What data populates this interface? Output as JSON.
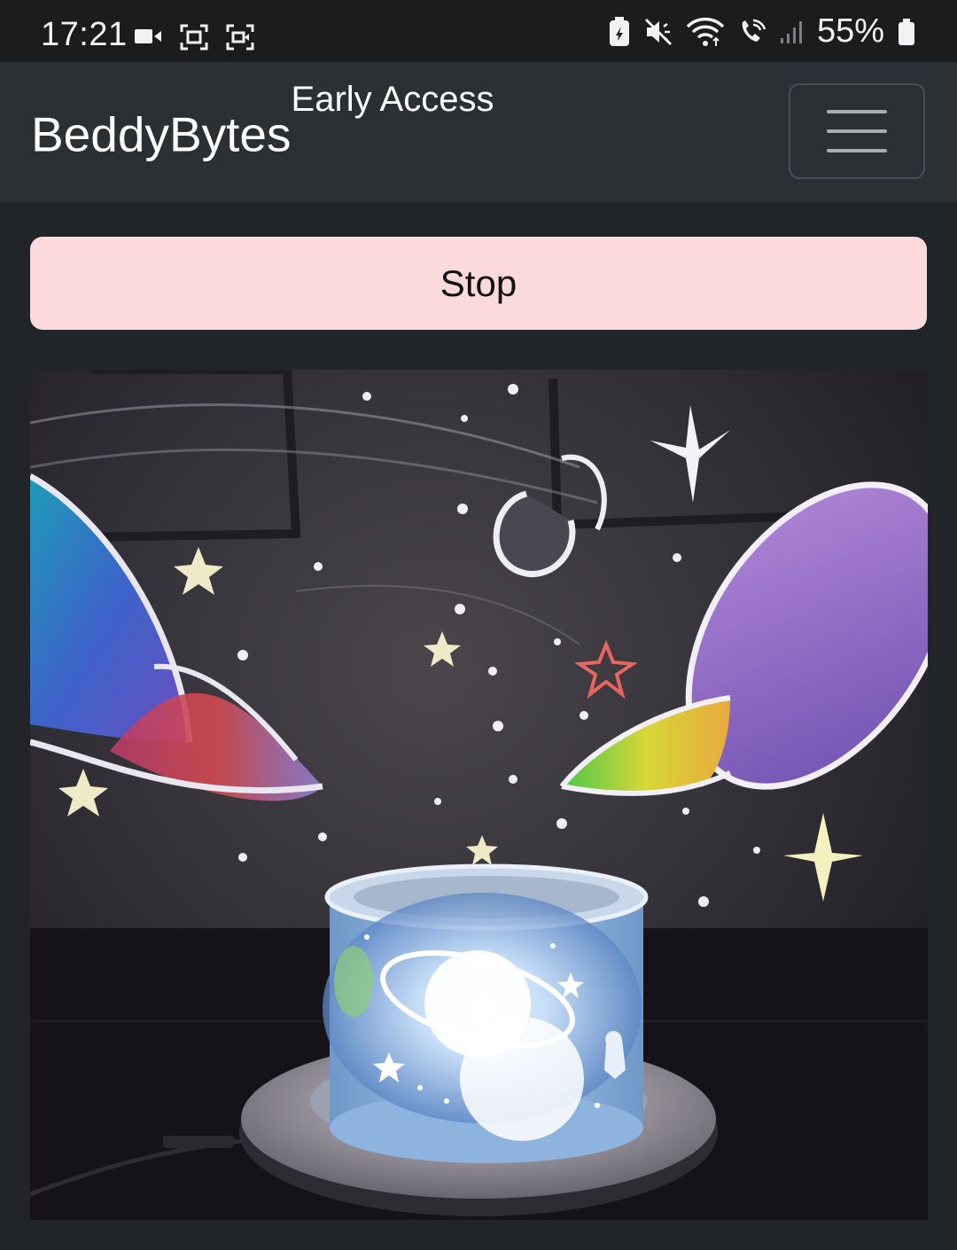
{
  "status_bar": {
    "time": "17:21",
    "battery_percent": "55%",
    "icons": [
      "video-call-icon",
      "screenshot-icon",
      "screen-record-icon",
      "battery-saver-icon",
      "mute-icon",
      "wifi-icon",
      "wifi-calling-icon",
      "signal-icon",
      "battery-icon"
    ]
  },
  "navbar": {
    "brand": "BeddyBytes",
    "brand_sup": "Early Access",
    "menu_icon": "hamburger-menu-icon"
  },
  "controls": {
    "stop_label": "Stop",
    "stop_color": "#fcd9db"
  },
  "video": {
    "description_icon": "camera-feed"
  }
}
